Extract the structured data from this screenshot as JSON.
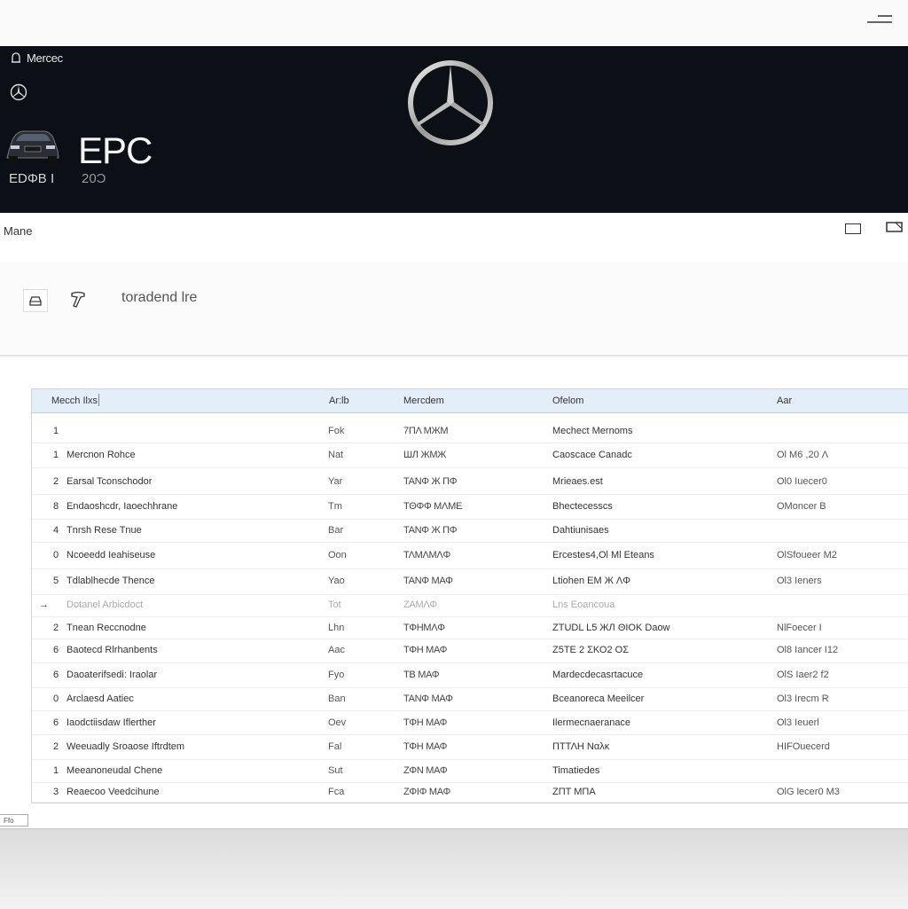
{
  "header": {
    "brand": "Mercec",
    "title": "EPC",
    "subtitle_left": "EDΦB I",
    "subtitle_right": "20Ͻ"
  },
  "main": {
    "label": "Mane",
    "toolbar_label": "toradend lre"
  },
  "table": {
    "columns": [
      "Mecch Ilxs",
      "Ar:lb",
      "Mercdem",
      "Ofelom",
      "Aar"
    ],
    "rows": [
      {
        "num": "1",
        "name": "",
        "abb": "Fok",
        "merc": "7ΠΛ МЖМ",
        "opt": "Mechect Mernoms",
        "ar": ""
      },
      {
        "num": "1",
        "name": "Mercnon Rohce",
        "abb": "Nat",
        "merc": "ШЛ ЖМЖ",
        "opt": "Caoscace Canadc",
        "ar": "Ol M6 ,20 Λ"
      },
      {
        "num": "2",
        "name": "Earsal Tconschodor",
        "abb": "Yar",
        "merc": "ΤΑΝΦ Ж ΠΦ",
        "opt": "Mrieaes.est",
        "ar": "Ol0 Iuecer0"
      },
      {
        "num": "8",
        "name": "Endaoshcdr, Iaoechhrane",
        "abb": "Tm",
        "merc": "ΤΘΦΦ ΜΛΜΕ",
        "opt": "Bhectecesscs",
        "ar": "OMoncer B"
      },
      {
        "num": "4",
        "name": "Tnrsh Rese Tnue",
        "abb": "Bar",
        "merc": "ΤΑΝΦ Ж ΠΦ",
        "opt": "Dahtiunisaes",
        "ar": ""
      },
      {
        "num": "0",
        "name": "Ncoeedd Ieahiseuse",
        "abb": "Oon",
        "merc": "ΤΛΜΛΜΛΦ",
        "opt": "Ercestes4,Ol Ml Eteans",
        "ar": "OlSfoueer M2"
      },
      {
        "num": "5",
        "name": "Tdlablhecde Thence",
        "abb": "Yao",
        "merc": "ΤΑΝΦ ΜΑΦ",
        "opt": "Ltiohen EM Ж ΛΦ",
        "ar": "Ol3 Ieners"
      },
      {
        "num": "",
        "name": "Dotanel Arbicdoct",
        "abb": "Tot",
        "merc": "ΖΑΜΛΦ",
        "opt": "Lns Eoancoua",
        "ar": ""
      },
      {
        "num": "2",
        "name": "Tnean Reccnodne",
        "abb": "Lhn",
        "merc": "ΤΦΗΜΛΦ",
        "opt": "ZTUDL L5 ЖЛ ΘΙΟΚ Daow",
        "ar": "NlFoecer I"
      },
      {
        "num": "6",
        "name": "Baotecd Rlrhanbents",
        "abb": "Aac",
        "merc": "ΤΦΗ ΜΑΦ",
        "opt": "Ζ5ΤΕ 2 ΣΚΟ2 ΟΣ",
        "ar": "Ol8 Iancer I12"
      },
      {
        "num": "6",
        "name": "Daoaterifsedi: Iraolar",
        "abb": "Fyo",
        "merc": "ΤΒ ΜΑΦ",
        "opt": "Mardecdecasrtacuce",
        "ar": "OlS Iaer2 f2"
      },
      {
        "num": "0",
        "name": "Arclaesd Aatiec",
        "abb": "Ban",
        "merc": "ΤΑΝΦ ΜΑΦ",
        "opt": "Bceanoreca Meeilcer",
        "ar": "Ol3 Irecm R"
      },
      {
        "num": "6",
        "name": "Iaodctiisdaw Iflerther",
        "abb": "Oev",
        "merc": "ΤΦΗ ΜΑΦ",
        "opt": "Ilermecnaeranace",
        "ar": "Ol3 Ieuerl"
      },
      {
        "num": "2",
        "name": "Weeuadly Sroaose Iftrdtem",
        "abb": "Fal",
        "merc": "ΤΦΗ ΜΑΦ",
        "opt": "ΠΤΤΛΗ Ναλκ",
        "ar": "HIFOuecerd"
      },
      {
        "num": "1",
        "name": "Meeanoneudal Chene",
        "abb": "Sut",
        "merc": "ΖΦΝ ΜΑΦ",
        "opt": "Timatiedes",
        "ar": ""
      },
      {
        "num": "3",
        "name": "Reaecoo Veedcihune",
        "abb": "Fca",
        "merc": "ΖΦΙΦ ΜΑΦ",
        "opt": "ΖΠΤ ΜΠΑ",
        "ar": "OlG lecer0 M3"
      }
    ]
  },
  "footer": {
    "tab_label": "Ffo"
  },
  "colors": {
    "banner": "#0c1016",
    "header_row": "#e4eef9"
  }
}
